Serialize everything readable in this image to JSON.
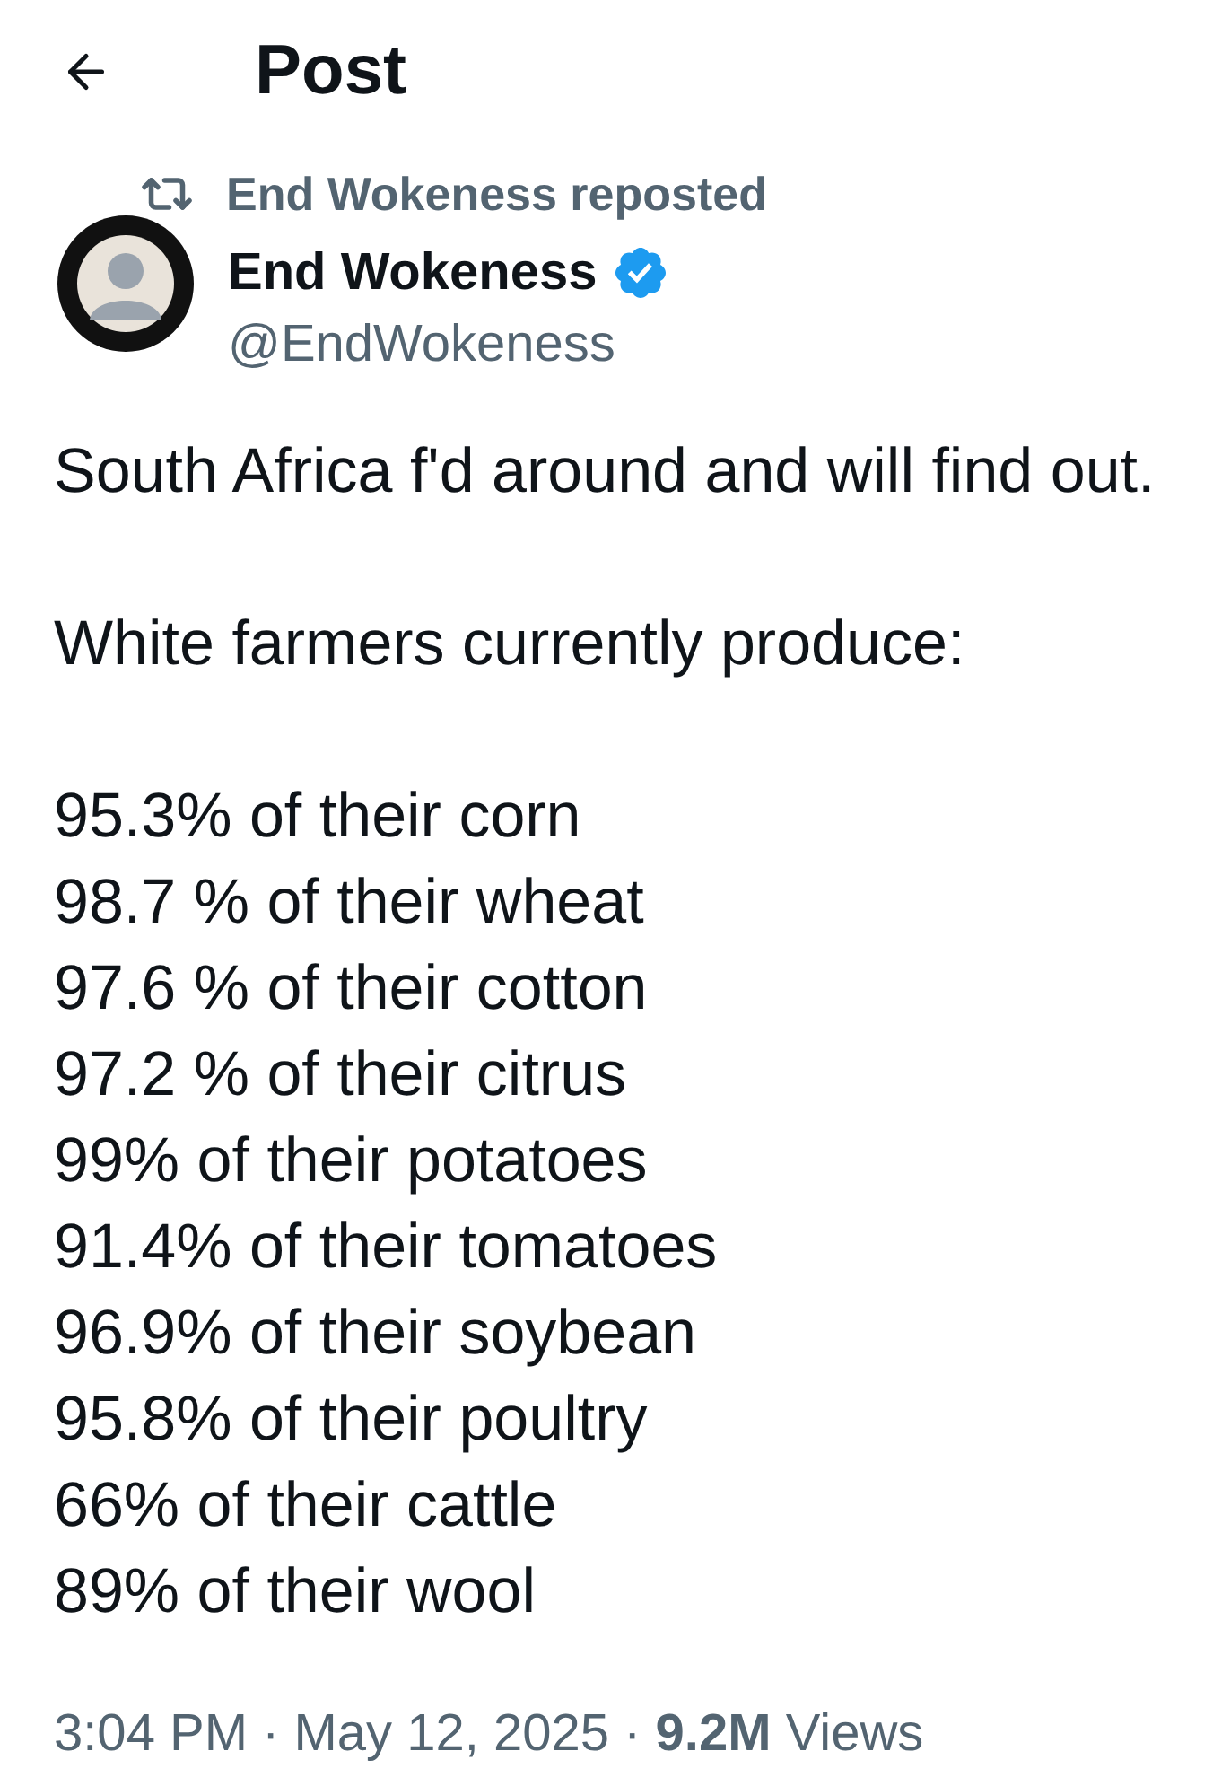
{
  "header": {
    "title": "Post"
  },
  "repost": {
    "label": "End Wokeness reposted"
  },
  "author": {
    "name": "End Wokeness",
    "verified": true,
    "handle": "@EndWokeness"
  },
  "body": {
    "paragraphs": [
      "South Africa f'd around and will find out.",
      "White farmers currently produce:"
    ],
    "list": [
      "95.3% of their corn",
      "98.7 % of their wheat",
      "97.6 % of their cotton",
      "97.2 % of their citrus",
      "99% of their potatoes",
      "91.4% of their tomatoes",
      "96.9% of their soybean",
      "95.8% of their poultry",
      "66% of their cattle",
      "89% of their wool"
    ]
  },
  "meta": {
    "line": "3:04 PM · May 12, 2025 · **9.2M** Views"
  }
}
